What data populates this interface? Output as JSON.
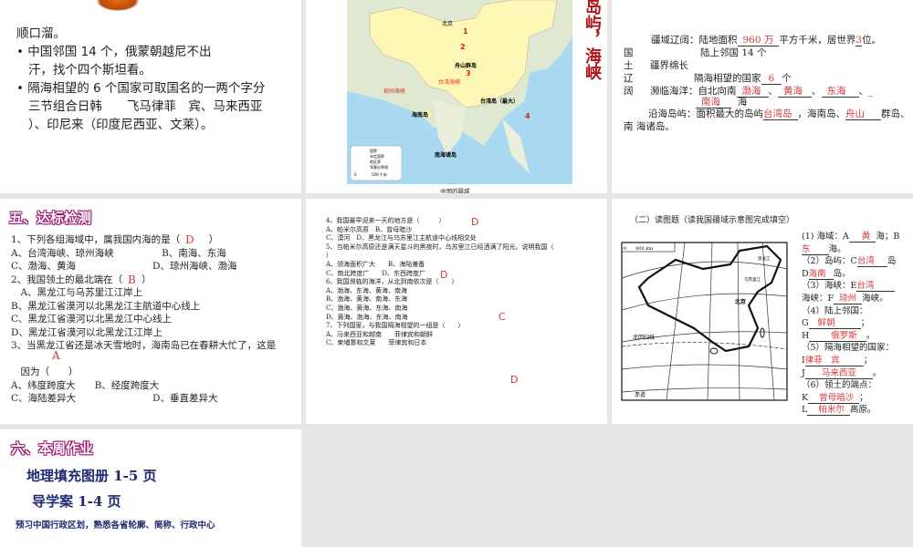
{
  "slide1": {
    "rhyme_end": "顺口溜。",
    "bullets": [
      [
        "中国邻国 14 个，俄蒙朝越尼不出",
        "汗，找个四个斯坦看。"
      ],
      [
        "隔海相望的 6 个国家可取国名的一两个字分",
        "三节组合日韩　　飞马律菲　宾、马来西亚",
        "）、印尼来（印度尼西亚、文莱）。"
      ]
    ]
  },
  "slide2": {
    "vertical_title": "岛屿，海峡",
    "caption": "中国的疆域",
    "labels": {
      "beijing": "北京",
      "n1": "1",
      "n2": "2",
      "n3": "3",
      "n4": "4",
      "zhoushan": "舟山群岛",
      "taiwan_strait": "台湾海峡",
      "qiongzhou_strait": "琼州海峡",
      "taiwan_island": "台湾岛（最大）",
      "hainan": "海南岛",
      "nanhai_islands": "南海诸岛"
    },
    "legend": [
      "国界",
      "未定国界",
      "地区界",
      "军事分界线"
    ],
    "scale": "500 千米",
    "scale_zero": "0"
  },
  "slide3": {
    "lines": [
      {
        "pre": "疆域辽阔：陆地面积",
        "a1": "960 万",
        "mid": "平方千米，居世界",
        "a2": "3",
        "post": "位。"
      },
      {
        "text": "陆上邻国 14 个"
      },
      {
        "text": "疆界绵长"
      },
      {
        "pre": "隔海相望的国家",
        "a1": "6",
        "post": "个"
      },
      {
        "pre": "濒临海洋：自北向南",
        "a1": "渤海",
        "a2": "黄海",
        "a3": "东海",
        "a4": "南海",
        "post": "海"
      },
      {
        "pre": "沿海岛屿：面积最大的岛屿",
        "a1": "台湾岛",
        "mid": "，海南岛、",
        "a2": "舟山",
        "post": "群岛、",
        "post2": "南 海诸岛。"
      }
    ],
    "side": [
      "国",
      "土",
      "辽",
      "阔"
    ]
  },
  "slide4": {
    "title": "五、达标检测",
    "lines": [
      "1、下列各组海域中，属我国内海的是（　　　）",
      "A、台湾海峡、琼州海峡　　　　　B、南海、东海",
      "C、渤海、黄海　　　　　　　　D、琼州海峡、渤海",
      "2、我国领土的最北端在（　　）",
      "　A、黑龙江与乌苏里江江岸上",
      "B、黑龙江省漠河以北黑龙江主航道中心线上",
      "C、黑龙江省漠河以北黑龙江中心线上",
      "D、黑龙江省漠河以北黑龙江江岸上",
      "3、当黑龙江省还是冰天雪地时，海南岛已在春耕大忙了，这是",
      "",
      "　因为（　　）",
      "A、纬度跨度大　　B、经度跨度大",
      "C、海陆差异大　　　　　　　　D、垂直差异大"
    ],
    "answers": {
      "q1": "D",
      "q2": "B",
      "q3": "A"
    }
  },
  "slide5": {
    "lines": [
      "4、我国最早迎来一天的地方是（　　　）",
      "A、帕米尔高原　B、曾母暗沙",
      "C、漠河　D、黑龙江与乌苏里江主航道中心线相交处",
      "5、当帕米尔高原还是满天星斗的黑夜时，乌苏里江已经洒满了阳光。说明我国（",
      "）",
      "A、领海面积广大　　B、海陆兼备",
      "C、南北跨度广　　D、东西跨度广",
      "6、我国濒临的海洋，从北到南依次是（　　）",
      "A、渤海、东海、黄海、南海",
      "B、渤海、黄海、南海、东海",
      "C、渤海、黄海、东海、南海",
      "D、黄海、渤海、东海、南海",
      "7、下列国家，与我国隔海相望的一组是（　　）",
      "A、马来西亚和越南　　菲律宾和朝鲜",
      "C、柬埔寨和文莱　　菲律宾和日本"
    ],
    "answers": {
      "q4": "D",
      "q5": "D",
      "q6": "C",
      "q7": "D"
    }
  },
  "slide6": {
    "heading": "（二）读图题（读我国疆域示意图完成填空）",
    "map_labels": {
      "scale": "0　　800 km",
      "beijing": "北京",
      "tropic": "北回归线",
      "equator": "赤道",
      "heilongjiang": "黑龙江",
      "wusuli": "乌苏里江"
    },
    "items": [
      {
        "text": "(1) 海域：A",
        "ans": "黄",
        "post": "海；B"
      },
      {
        "ans": "东",
        "post": "海。"
      },
      {
        "text": "（2）岛屿：C",
        "ans": "台湾",
        "post": "岛"
      },
      {
        "text": "D",
        "ans": "海南",
        "post": "岛。"
      },
      {
        "text": "（3）海峡：E",
        "ans": "台湾"
      },
      {
        "text": "海峡：F",
        "ans": "琼州",
        "post": "海峡。"
      },
      {
        "text": "（4）陆上邻国："
      },
      {
        "text": "G",
        "ans": "鲜朝",
        "post": "；"
      },
      {
        "text": "H",
        "ans": "俄罗斯",
        "post": "。"
      },
      {
        "text": "（5）隔海相望的国家："
      },
      {
        "text": "I",
        "ans": "律菲　宾",
        "post": "；"
      },
      {
        "text": "J",
        "ans": "马来西亚",
        "post": "。"
      },
      {
        "text": "（6）领土的端点："
      },
      {
        "text": "K",
        "ans": "曾母暗沙",
        "post": "；"
      },
      {
        "text": "L",
        "ans": "帕米尔",
        "post": "高原。"
      }
    ]
  },
  "slide7": {
    "title": "六、本周作业",
    "lines": [
      "地理填充图册 1-5 页",
      "导学案 1-4 页",
      "预习中国行政区划，熟悉各省轮廓、简称、行政中心"
    ]
  }
}
